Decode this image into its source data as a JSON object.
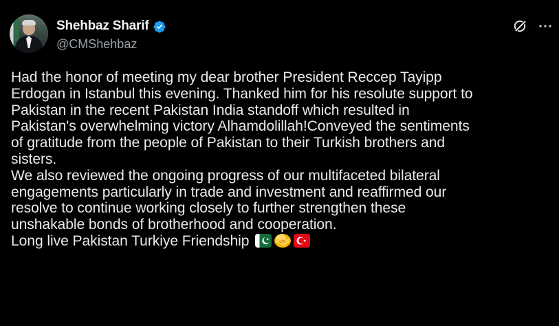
{
  "post": {
    "author": {
      "display_name": "Shehbaz Sharif",
      "handle": "@CMShehbaz",
      "verified": true,
      "avatar": "profile-photo"
    },
    "actions": {
      "grok_icon": "grok-icon",
      "more_icon": "more-icon"
    },
    "text_lines": [
      "Had the honor of meeting my dear brother President Reccep Tayipp",
      "Erdogan in Istanbul this evening. Thanked him for his resolute support to",
      "Pakistan in the recent Pakistan India standoff which resulted in",
      "Pakistan's overwhelming victory Alhamdolillah!Conveyed the sentiments",
      "of gratitude from the people of Pakistan to their Turkish brothers and",
      "sisters.",
      "We also reviewed the ongoing progress of our multifaceted bilateral",
      "engagements particularly in trade and investment and reaffirmed our",
      "resolve to continue working closely to further strengthen these",
      "unshakable bonds of brotherhood and cooperation.",
      "Long live Pakistan Turkiye Friendship"
    ],
    "emojis": [
      "pakistan-flag-emoji",
      "handshake-emoji",
      "turkey-flag-emoji"
    ]
  },
  "theme": {
    "background": "#000000",
    "text": "#e8eaed",
    "secondary_text": "#9aa1a8",
    "verified_blue": "#1d9bf0"
  }
}
